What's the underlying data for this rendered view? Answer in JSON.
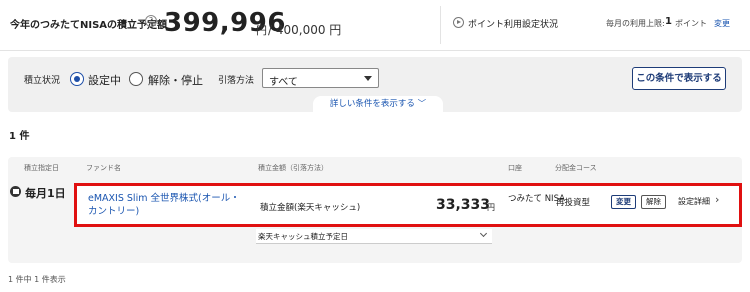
{
  "header": {
    "label": "今年のつみたてNISAの積立予定額",
    "help_icon": "?",
    "amount": "399,996",
    "yen": "円",
    "limit": "/ 400,000 円",
    "points_link": "ポイント利用設定状況",
    "points_limit_label": "毎月の利用上限:",
    "points_limit_value": "1",
    "points_limit_unit": "ポイント",
    "points_change": "変更"
  },
  "filter": {
    "status_label": "積立状況",
    "opt_active": "設定中",
    "opt_cancel": "解除・停止",
    "selected": "設定中",
    "method_label": "引落方法",
    "method_value": "すべて",
    "show_button": "この条件で表示する",
    "more_link": "詳しい条件を表示する ﹀"
  },
  "results": {
    "count": "1 件",
    "footer": "1 件中 1 件表示",
    "columns": [
      "積立指定日",
      "ファンド名",
      "積立金額（引落方法）",
      "口座",
      "分配金コース"
    ],
    "rows": [
      {
        "day": "毎月1日",
        "fund": "eMAXIS Slim 全世界株式(オール・カントリー)",
        "amount_label": "積立金額(楽天キャッシュ)",
        "amount": "33,333",
        "yen": "円",
        "account": "つみたて NISA",
        "course": "再投資型",
        "btn_change": "変更",
        "btn_cancel": "解除",
        "detail": "設定詳細",
        "cash_date": "楽天キャッシュ積立予定日"
      }
    ]
  },
  "colors": {
    "accent": "#1e4fa8",
    "highlight": "#e01010",
    "link": "#1a55b0"
  }
}
